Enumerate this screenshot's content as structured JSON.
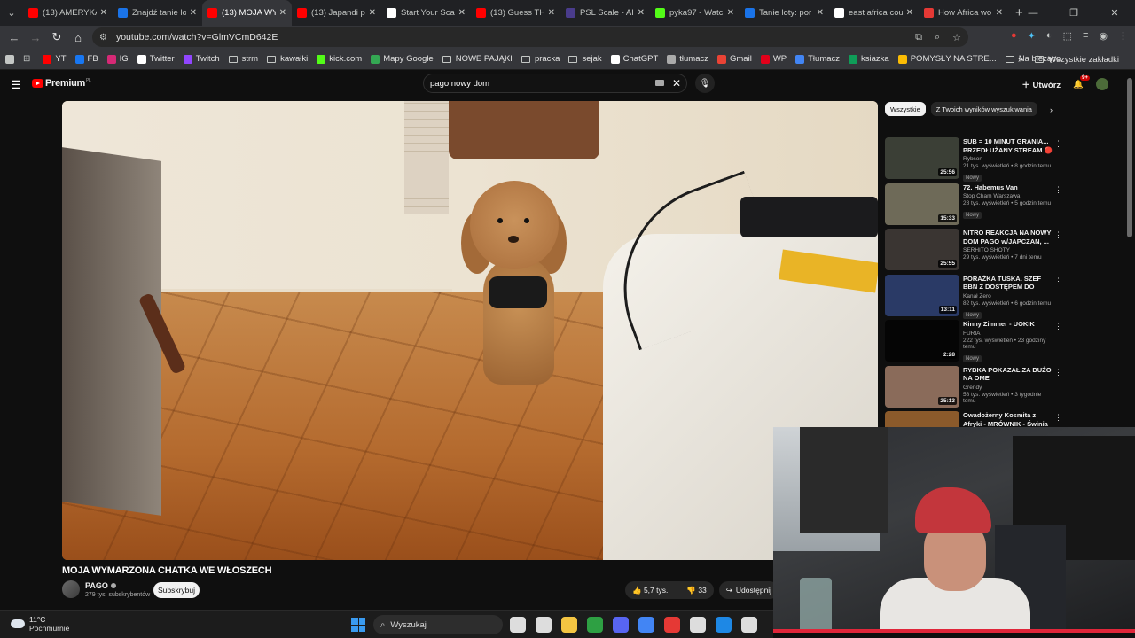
{
  "browser": {
    "tabs": [
      {
        "title": "(13) AMERYKA",
        "favicon_color": "#ff0000",
        "active": false
      },
      {
        "title": "Znajdź tanie lo",
        "favicon_color": "#1a73e8",
        "active": false
      },
      {
        "title": "(13) MOJA WY",
        "favicon_color": "#ff0000",
        "active": true
      },
      {
        "title": "(13) Japandi p",
        "favicon_color": "#ff0000",
        "active": false
      },
      {
        "title": "Start Your Sca",
        "favicon_color": "#ffffff",
        "active": false
      },
      {
        "title": "(13) Guess TH",
        "favicon_color": "#ff0000",
        "active": false
      },
      {
        "title": "PSL Scale - AI",
        "favicon_color": "#4a3c8c",
        "active": false
      },
      {
        "title": "pyka97 - Watc",
        "favicon_color": "#53fc18",
        "active": false
      },
      {
        "title": "Tanie loty: por",
        "favicon_color": "#1a73e8",
        "active": false
      },
      {
        "title": "east africa cou",
        "favicon_color": "#ffffff",
        "active": false
      },
      {
        "title": "How Africa wo",
        "favicon_color": "#e53935",
        "active": false
      }
    ],
    "url": "youtube.com/watch?v=GlmVCmD642E",
    "bookmarks": [
      {
        "label": "YT",
        "color": "#ff0000"
      },
      {
        "label": "FB",
        "color": "#1877f2"
      },
      {
        "label": "IG",
        "color": "#d62976"
      },
      {
        "label": "Twitter",
        "color": "#ffffff"
      },
      {
        "label": "Twitch",
        "color": "#9146ff"
      },
      {
        "label": "strm",
        "color": "folder"
      },
      {
        "label": "kawałki",
        "color": "folder"
      },
      {
        "label": "kick.com",
        "color": "#53fc18"
      },
      {
        "label": "Mapy Google",
        "color": "#34a853"
      },
      {
        "label": "NOWE PAJĄKI",
        "color": "folder"
      },
      {
        "label": "pracka",
        "color": "folder"
      },
      {
        "label": "sejak",
        "color": "folder"
      },
      {
        "label": "ChatGPT",
        "color": "#ffffff"
      },
      {
        "label": "tłumacz",
        "color": "#aaaaaa"
      },
      {
        "label": "Gmail",
        "color": "#ea4335"
      },
      {
        "label": "WP",
        "color": "#e2001a"
      },
      {
        "label": "Tłumacz",
        "color": "#4285f4"
      },
      {
        "label": "ksiazka",
        "color": "#0f9d58"
      },
      {
        "label": "POMYSŁY NA STRE...",
        "color": "#fbbc04"
      },
      {
        "label": "Na bieżąco",
        "color": "folder"
      }
    ],
    "all_bookmarks": "Wszystkie zakładki"
  },
  "youtube": {
    "logo_text": "Premium",
    "logo_region": "PL",
    "search_value": "pago nowy dom",
    "create_label": "Utwórz",
    "notif_count": "9+",
    "video": {
      "title": "MOJA WYMARZONA CHATKA WE WŁOSZECH",
      "channel": "PAGO",
      "subscribers": "279 tys. subskrybentów",
      "subscribe_label": "Subskrybuj",
      "likes": "5,7 tys.",
      "dislikes": "33",
      "share_label": "Udostępnij"
    },
    "chips": [
      "Wszystkie",
      "Z Twoich wyników wyszukiwania"
    ],
    "related": [
      {
        "title": "SUB = 10 MINUT GRANIA... PRZEDŁUŻANY STREAM 🔴 ...",
        "channel": "Rybson",
        "stats": "21 tys. wyświetleń • 8 godzin temu",
        "duration": "25:56",
        "new": "Nowy",
        "thumb": "#3b3f36"
      },
      {
        "title": "72. Habemus Van",
        "channel": "Stop Cham Warszawa",
        "stats": "28 tys. wyświetleń • 5 godzin temu",
        "duration": "15:33",
        "new": "Nowy",
        "thumb": "#6e6a58"
      },
      {
        "title": "NITRO REAKCJA NA NOWY DOM PAGO w/JAPCZAN, ...",
        "channel": "SERHITO SHOTY",
        "stats": "29 tys. wyświetleń • 7 dni temu",
        "duration": "25:55",
        "new": "",
        "thumb": "#3a3532"
      },
      {
        "title": "PORAŻKA TUSKA. SZEF BBN Z DOSTĘPEM DO INFORMACJI ...",
        "channel": "Kanał Zero",
        "stats": "82 tys. wyświetleń • 6 godzin temu",
        "duration": "13:11",
        "new": "Nowy",
        "thumb": "#2a3a66"
      },
      {
        "title": "Kinny Zimmer - UOKIK",
        "channel": "FURIA",
        "stats": "222 tys. wyświetleń • 23 godziny temu",
        "duration": "2:28",
        "new": "Nowy",
        "thumb": "#050505"
      },
      {
        "title": "RYBKA POKAZAŁ ZA DUŻO NA OME",
        "channel": "Grendy",
        "stats": "58 tys. wyświetleń • 3 tygodnie temu",
        "duration": "25:13",
        "new": "",
        "thumb": "#8a6b5a"
      },
      {
        "title": "Owadożerny Kosmita z Afryki - MRÓWNIK - Świnia Ziemna",
        "channel": "Magia Natury",
        "stats": "",
        "duration": "",
        "new": "",
        "thumb": "#8b5a2b"
      }
    ]
  },
  "taskbar": {
    "temperature": "11°C",
    "condition": "Pochmurnie",
    "search_placeholder": "Wyszukaj",
    "icon_colors": [
      "#ffffff",
      "#ffffff",
      "#f4c542",
      "#2ea043",
      "#5865f2",
      "#4285f4",
      "#e53935",
      "#ffffff",
      "#1e88e5",
      "#ffffff"
    ]
  }
}
